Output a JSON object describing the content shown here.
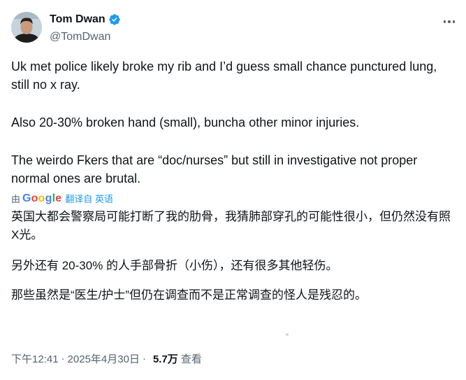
{
  "author": {
    "name": "Tom Dwan",
    "handle": "@TomDwan"
  },
  "tweet": {
    "paragraphs": [
      "Uk met police likely broke my rib and I’d guess small chance punctured lung, still no x ray.",
      "Also 20-30% broken hand (small), buncha other minor injuries.",
      "The weirdo Fkers that are “doc/nurses” but still in investigative not proper normal ones are brutal."
    ]
  },
  "translation": {
    "prefix": "由",
    "provider": "Google",
    "action": "翻译自 英语",
    "paragraphs": [
      "英国大都会警察局可能打断了我的肋骨，我猜肺部穿孔的可能性很小，但仍然没有照X光。",
      "另外还有 20-30% 的人手部骨折（小伤），还有很多其他轻伤。",
      "那些虽然是“医生/护士”但仍在调查而不是正常调查的怪人是残忍的。"
    ]
  },
  "meta": {
    "time": "下午12:41",
    "date": "2025年4月30日",
    "separator": "·",
    "views": "5.7万",
    "views_label": "查看"
  },
  "colors": {
    "accent": "#1d9bf0",
    "secondary_text": "#536471",
    "primary_text": "#0f1419",
    "google_blue": "#4285F4",
    "google_red": "#EA4335",
    "google_yellow": "#FBBC05",
    "google_green": "#34A853"
  },
  "icons": {
    "verified": "verified-badge-icon",
    "more": "more-icon"
  }
}
